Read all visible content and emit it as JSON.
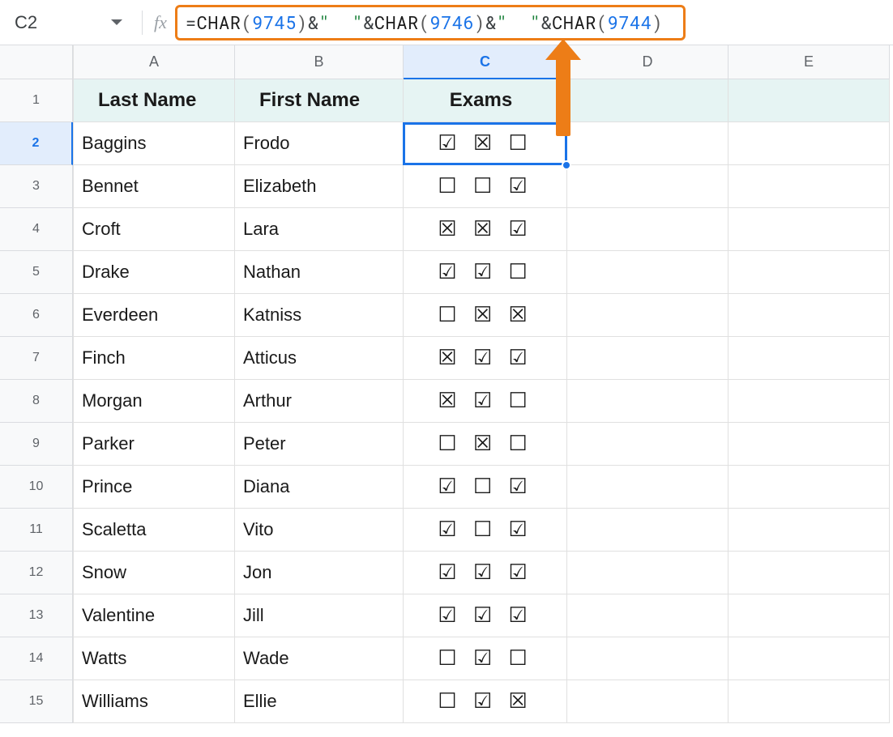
{
  "name_box": "C2",
  "fx_label": "fx",
  "formula": {
    "raw": "=CHAR(9745)&\"  \"&CHAR(9746)&\"  \"&CHAR(9744)",
    "eq": "=",
    "fn": "CHAR",
    "open": "(",
    "close": ")",
    "amp": "&",
    "quote": "\"",
    "space2": "  ",
    "n1": "9745",
    "n2": "9746",
    "n3": "9744"
  },
  "columns": [
    "A",
    "B",
    "C",
    "D",
    "E"
  ],
  "selected_column_index": 2,
  "selected_row_num": 2,
  "header": {
    "a": "Last Name",
    "b": "First Name",
    "c": "Exams"
  },
  "rows": [
    {
      "num": "1",
      "a": "",
      "b": "",
      "c": ""
    },
    {
      "num": "2",
      "a": "Baggins",
      "b": "Frodo",
      "c": "☑ ☒ ☐"
    },
    {
      "num": "3",
      "a": "Bennet",
      "b": "Elizabeth",
      "c": "☐ ☐ ☑"
    },
    {
      "num": "4",
      "a": "Croft",
      "b": "Lara",
      "c": "☒ ☒ ☑"
    },
    {
      "num": "5",
      "a": "Drake",
      "b": "Nathan",
      "c": "☑ ☑ ☐"
    },
    {
      "num": "6",
      "a": "Everdeen",
      "b": "Katniss",
      "c": "☐ ☒ ☒"
    },
    {
      "num": "7",
      "a": "Finch",
      "b": "Atticus",
      "c": "☒ ☑ ☑"
    },
    {
      "num": "8",
      "a": "Morgan",
      "b": "Arthur",
      "c": "☒ ☑ ☐"
    },
    {
      "num": "9",
      "a": "Parker",
      "b": "Peter",
      "c": "☐ ☒ ☐"
    },
    {
      "num": "10",
      "a": "Prince",
      "b": "Diana",
      "c": "☑ ☐ ☑"
    },
    {
      "num": "11",
      "a": "Scaletta",
      "b": "Vito",
      "c": "☑ ☐ ☑"
    },
    {
      "num": "12",
      "a": "Snow",
      "b": "Jon",
      "c": "☑ ☑ ☑"
    },
    {
      "num": "13",
      "a": "Valentine",
      "b": "Jill",
      "c": "☑ ☑ ☑"
    },
    {
      "num": "14",
      "a": "Watts",
      "b": "Wade",
      "c": "☐ ☑ ☐"
    },
    {
      "num": "15",
      "a": "Williams",
      "b": "Ellie",
      "c": "☐ ☑ ☒"
    }
  ]
}
